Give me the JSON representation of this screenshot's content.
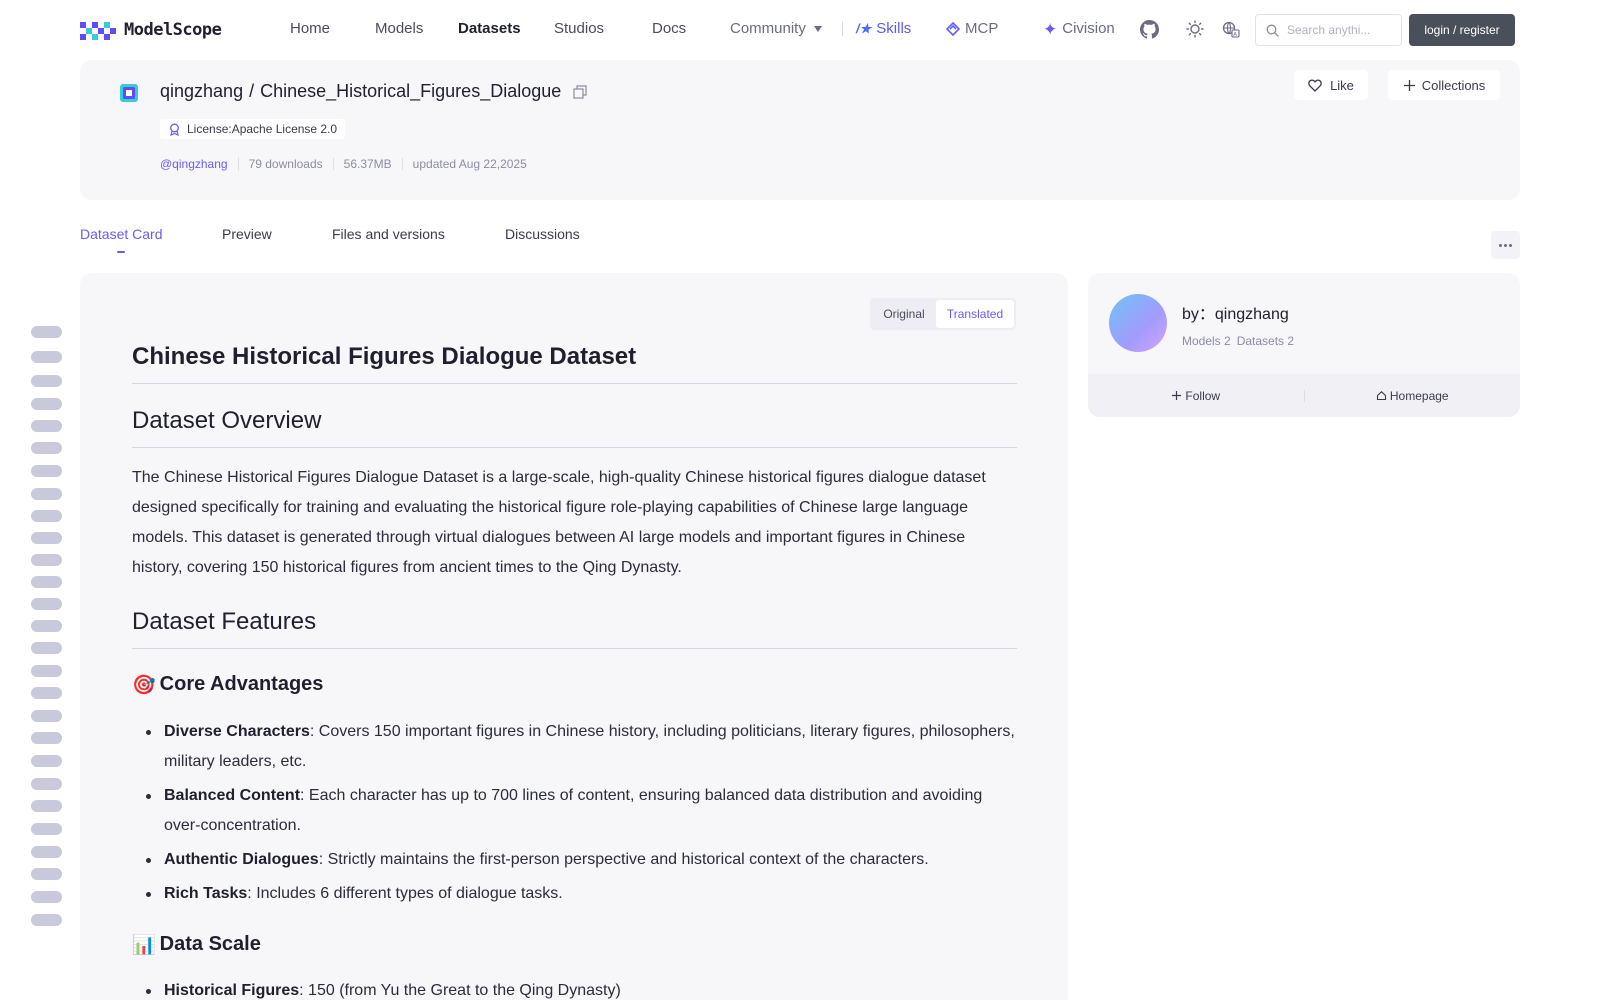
{
  "brand": {
    "name": "ModelScope"
  },
  "nav": {
    "home": "Home",
    "models": "Models",
    "datasets": "Datasets",
    "studios": "Studios",
    "docs": "Docs",
    "community": "Community",
    "skills": "Skills",
    "mcp": "MCP",
    "civision": "Civision"
  },
  "search": {
    "placeholder": "Search anythi..."
  },
  "auth": {
    "login_label": "login / register"
  },
  "repo": {
    "owner": "qingzhang",
    "separator": "/",
    "name": "Chinese_Historical_Figures_Dialogue",
    "license": "License:Apache License 2.0",
    "owner_handle": "@qingzhang",
    "downloads": "79 downloads",
    "size": "56.37MB",
    "updated": "updated Aug 22,2025",
    "like_label": "Like",
    "collections_label": "Collections"
  },
  "tabs": [
    {
      "label": "Dataset Card",
      "active": true
    },
    {
      "label": "Preview",
      "active": false
    },
    {
      "label": "Files and versions",
      "active": false
    },
    {
      "label": "Discussions",
      "active": false
    }
  ],
  "view_toggle": {
    "original": "Original",
    "translated": "Translated",
    "selected": "translated"
  },
  "article": {
    "title": "Chinese Historical Figures Dialogue Dataset",
    "overview_heading": "Dataset Overview",
    "overview_text": "The Chinese Historical Figures Dialogue Dataset is a large-scale, high-quality Chinese historical figures dialogue dataset designed specifically for training and evaluating the historical figure role-playing capabilities of Chinese large language models. This dataset is generated through virtual dialogues between AI large models and important figures in Chinese history, covering 150 historical figures from ancient times to the Qing Dynasty.",
    "features_heading": "Dataset Features",
    "advantages": {
      "emoji": "🎯",
      "heading": "Core Advantages",
      "items": [
        {
          "term": "Diverse Characters",
          "text": ": Covers 150 important figures in Chinese history, including politicians, literary figures, philosophers, military leaders, etc."
        },
        {
          "term": "Balanced Content",
          "text": ": Each character has up to 700 lines of content, ensuring balanced data distribution and avoiding over-concentration."
        },
        {
          "term": "Authentic Dialogues",
          "text": ": Strictly maintains the first-person perspective and historical context of the characters."
        },
        {
          "term": "Rich Tasks",
          "text": ": Includes 6 different types of dialogue tasks."
        }
      ]
    },
    "scale": {
      "emoji": "📊",
      "heading": "Data Scale",
      "items": [
        {
          "term": "Historical Figures",
          "text": ": 150 (from Yu the Great to the Qing Dynasty)"
        }
      ]
    }
  },
  "author": {
    "by_label": "by：qingzhang",
    "models": "Models 2",
    "datasets": "Datasets 2",
    "follow_label": "Follow",
    "homepage_label": "Homepage"
  },
  "colors": {
    "accent": "#6a5af9",
    "card_bg": "#f7f7fa",
    "login_bg": "#4a4f5c"
  }
}
